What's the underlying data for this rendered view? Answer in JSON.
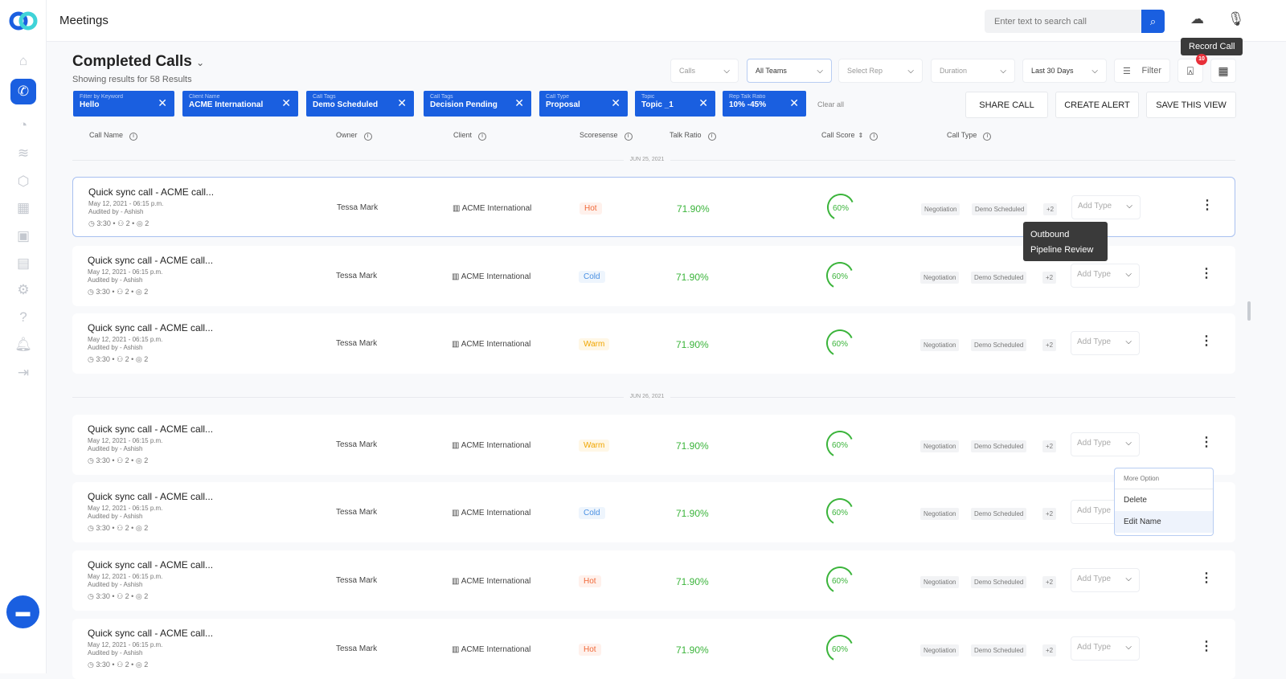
{
  "app": {
    "title": "Meetings",
    "search_placeholder": "Enter text to search call",
    "tooltip_record": "Record Call",
    "alert_count": "10"
  },
  "sidebar": {
    "items": [
      "home",
      "calls",
      "analytics",
      "layers",
      "team",
      "calendar",
      "contacts",
      "reports",
      "settings",
      "help",
      "notifications",
      "logout"
    ],
    "active": "calls"
  },
  "page": {
    "title": "Completed Calls",
    "subtitle": "Showing results for 58 Results"
  },
  "filters": {
    "dropdowns": [
      "Calls",
      "All Teams",
      "Select Rep",
      "Duration",
      "Last 30 Days"
    ],
    "filter_label": "Filter"
  },
  "chips": [
    {
      "label": "Filter by Keyword",
      "value": "Hello"
    },
    {
      "label": "Client Name",
      "value": "ACME International"
    },
    {
      "label": "Call Tags",
      "value": "Demo Scheduled"
    },
    {
      "label": "Call Tags",
      "value": "Decision Pending"
    },
    {
      "label": "Call Type",
      "value": "Proposal"
    },
    {
      "label": "Topic",
      "value": "Topic _1"
    },
    {
      "label": "Rep Talk Ratio",
      "value": "10% -45%"
    }
  ],
  "clear_all": "Clear all",
  "actions": {
    "share": "SHARE CALL",
    "alert": "CREATE ALERT",
    "save": "SAVE THIS VIEW"
  },
  "columns": [
    "Call Name",
    "Owner",
    "Client",
    "Scoresense",
    "Talk Ratio",
    "Call Score",
    "Call Type"
  ],
  "colors": {
    "accent": "#1a5fe0",
    "hot": "#f06a3a",
    "cold": "#4a90e2",
    "warm": "#f0a500",
    "good": "#3bb43b"
  },
  "groups": [
    {
      "date": "JUN 25, 2021",
      "rows": [
        0,
        1,
        2
      ]
    },
    {
      "date": "JUN 26, 2021",
      "rows": [
        3,
        4,
        5,
        6
      ]
    }
  ],
  "rows": [
    {
      "name": "Quick sync call - ACME call...",
      "date": "May 12, 2021 - 06:15 p.m.",
      "audited": "Audited by - Ashish",
      "duration": "3:30",
      "participants": "2",
      "comments": "2",
      "owner": "Tessa Mark",
      "client": "ACME International",
      "scoresense": "Hot",
      "talk_ratio": "71.90%",
      "call_score": 60,
      "call_score_label": "60%",
      "tags": [
        "Negotiation",
        "Demo Scheduled",
        "+2"
      ],
      "type_placeholder": "Add Type"
    },
    {
      "name": "Quick sync call - ACME call...",
      "date": "May 12, 2021 - 06:15 p.m.",
      "audited": "Audited by - Ashish",
      "duration": "3:30",
      "participants": "2",
      "comments": "2",
      "owner": "Tessa Mark",
      "client": "ACME International",
      "scoresense": "Cold",
      "talk_ratio": "71.90%",
      "call_score": 60,
      "call_score_label": "60%",
      "tags": [
        "Negotiation",
        "Demo Scheduled",
        "+2"
      ],
      "type_placeholder": "Add Type"
    },
    {
      "name": "Quick sync call - ACME call...",
      "date": "May 12, 2021 - 06:15 p.m.",
      "audited": "Audited by - Ashish",
      "duration": "3:30",
      "participants": "2",
      "comments": "2",
      "owner": "Tessa Mark",
      "client": "ACME International",
      "scoresense": "Warm",
      "talk_ratio": "71.90%",
      "call_score": 60,
      "call_score_label": "60%",
      "tags": [
        "Negotiation",
        "Demo Scheduled",
        "+2"
      ],
      "type_placeholder": "Add Type"
    },
    {
      "name": "Quick sync call - ACME call...",
      "date": "May 12, 2021 - 06:15 p.m.",
      "audited": "Audited by - Ashish",
      "duration": "3:30",
      "participants": "2",
      "comments": "2",
      "owner": "Tessa Mark",
      "client": "ACME International",
      "scoresense": "Warm",
      "talk_ratio": "71.90%",
      "call_score": 60,
      "call_score_label": "60%",
      "tags": [
        "Negotiation",
        "Demo Scheduled",
        "+2"
      ],
      "type_placeholder": "Add Type"
    },
    {
      "name": "Quick sync call - ACME call...",
      "date": "May 12, 2021 - 06:15 p.m.",
      "audited": "Audited by - Ashish",
      "duration": "3:30",
      "participants": "2",
      "comments": "2",
      "owner": "Tessa Mark",
      "client": "ACME International",
      "scoresense": "Cold",
      "talk_ratio": "71.90%",
      "call_score": 60,
      "call_score_label": "60%",
      "tags": [
        "Negotiation",
        "Demo Scheduled",
        "+2"
      ],
      "type_placeholder": "Add Type"
    },
    {
      "name": "Quick sync call - ACME call...",
      "date": "May 12, 2021 - 06:15 p.m.",
      "audited": "Audited by - Ashish",
      "duration": "3:30",
      "participants": "2",
      "comments": "2",
      "owner": "Tessa Mark",
      "client": "ACME International",
      "scoresense": "Hot",
      "talk_ratio": "71.90%",
      "call_score": 60,
      "call_score_label": "60%",
      "tags": [
        "Negotiation",
        "Demo Scheduled",
        "+2"
      ],
      "type_placeholder": "Add Type"
    },
    {
      "name": "Quick sync call - ACME call...",
      "date": "May 12, 2021 - 06:15 p.m.",
      "audited": "Audited by - Ashish",
      "duration": "3:30",
      "participants": "2",
      "comments": "2",
      "owner": "Tessa Mark",
      "client": "ACME International",
      "scoresense": "Hot",
      "talk_ratio": "71.90%",
      "call_score": 60,
      "call_score_label": "60%",
      "tags": [
        "Negotiation",
        "Demo Scheduled",
        "+2"
      ],
      "type_placeholder": "Add Type"
    }
  ],
  "type_tooltip": [
    "Outbound",
    "Pipeline Review"
  ],
  "more_menu": {
    "title": "More Option",
    "items": [
      "Delete",
      "Edit Name"
    ]
  }
}
